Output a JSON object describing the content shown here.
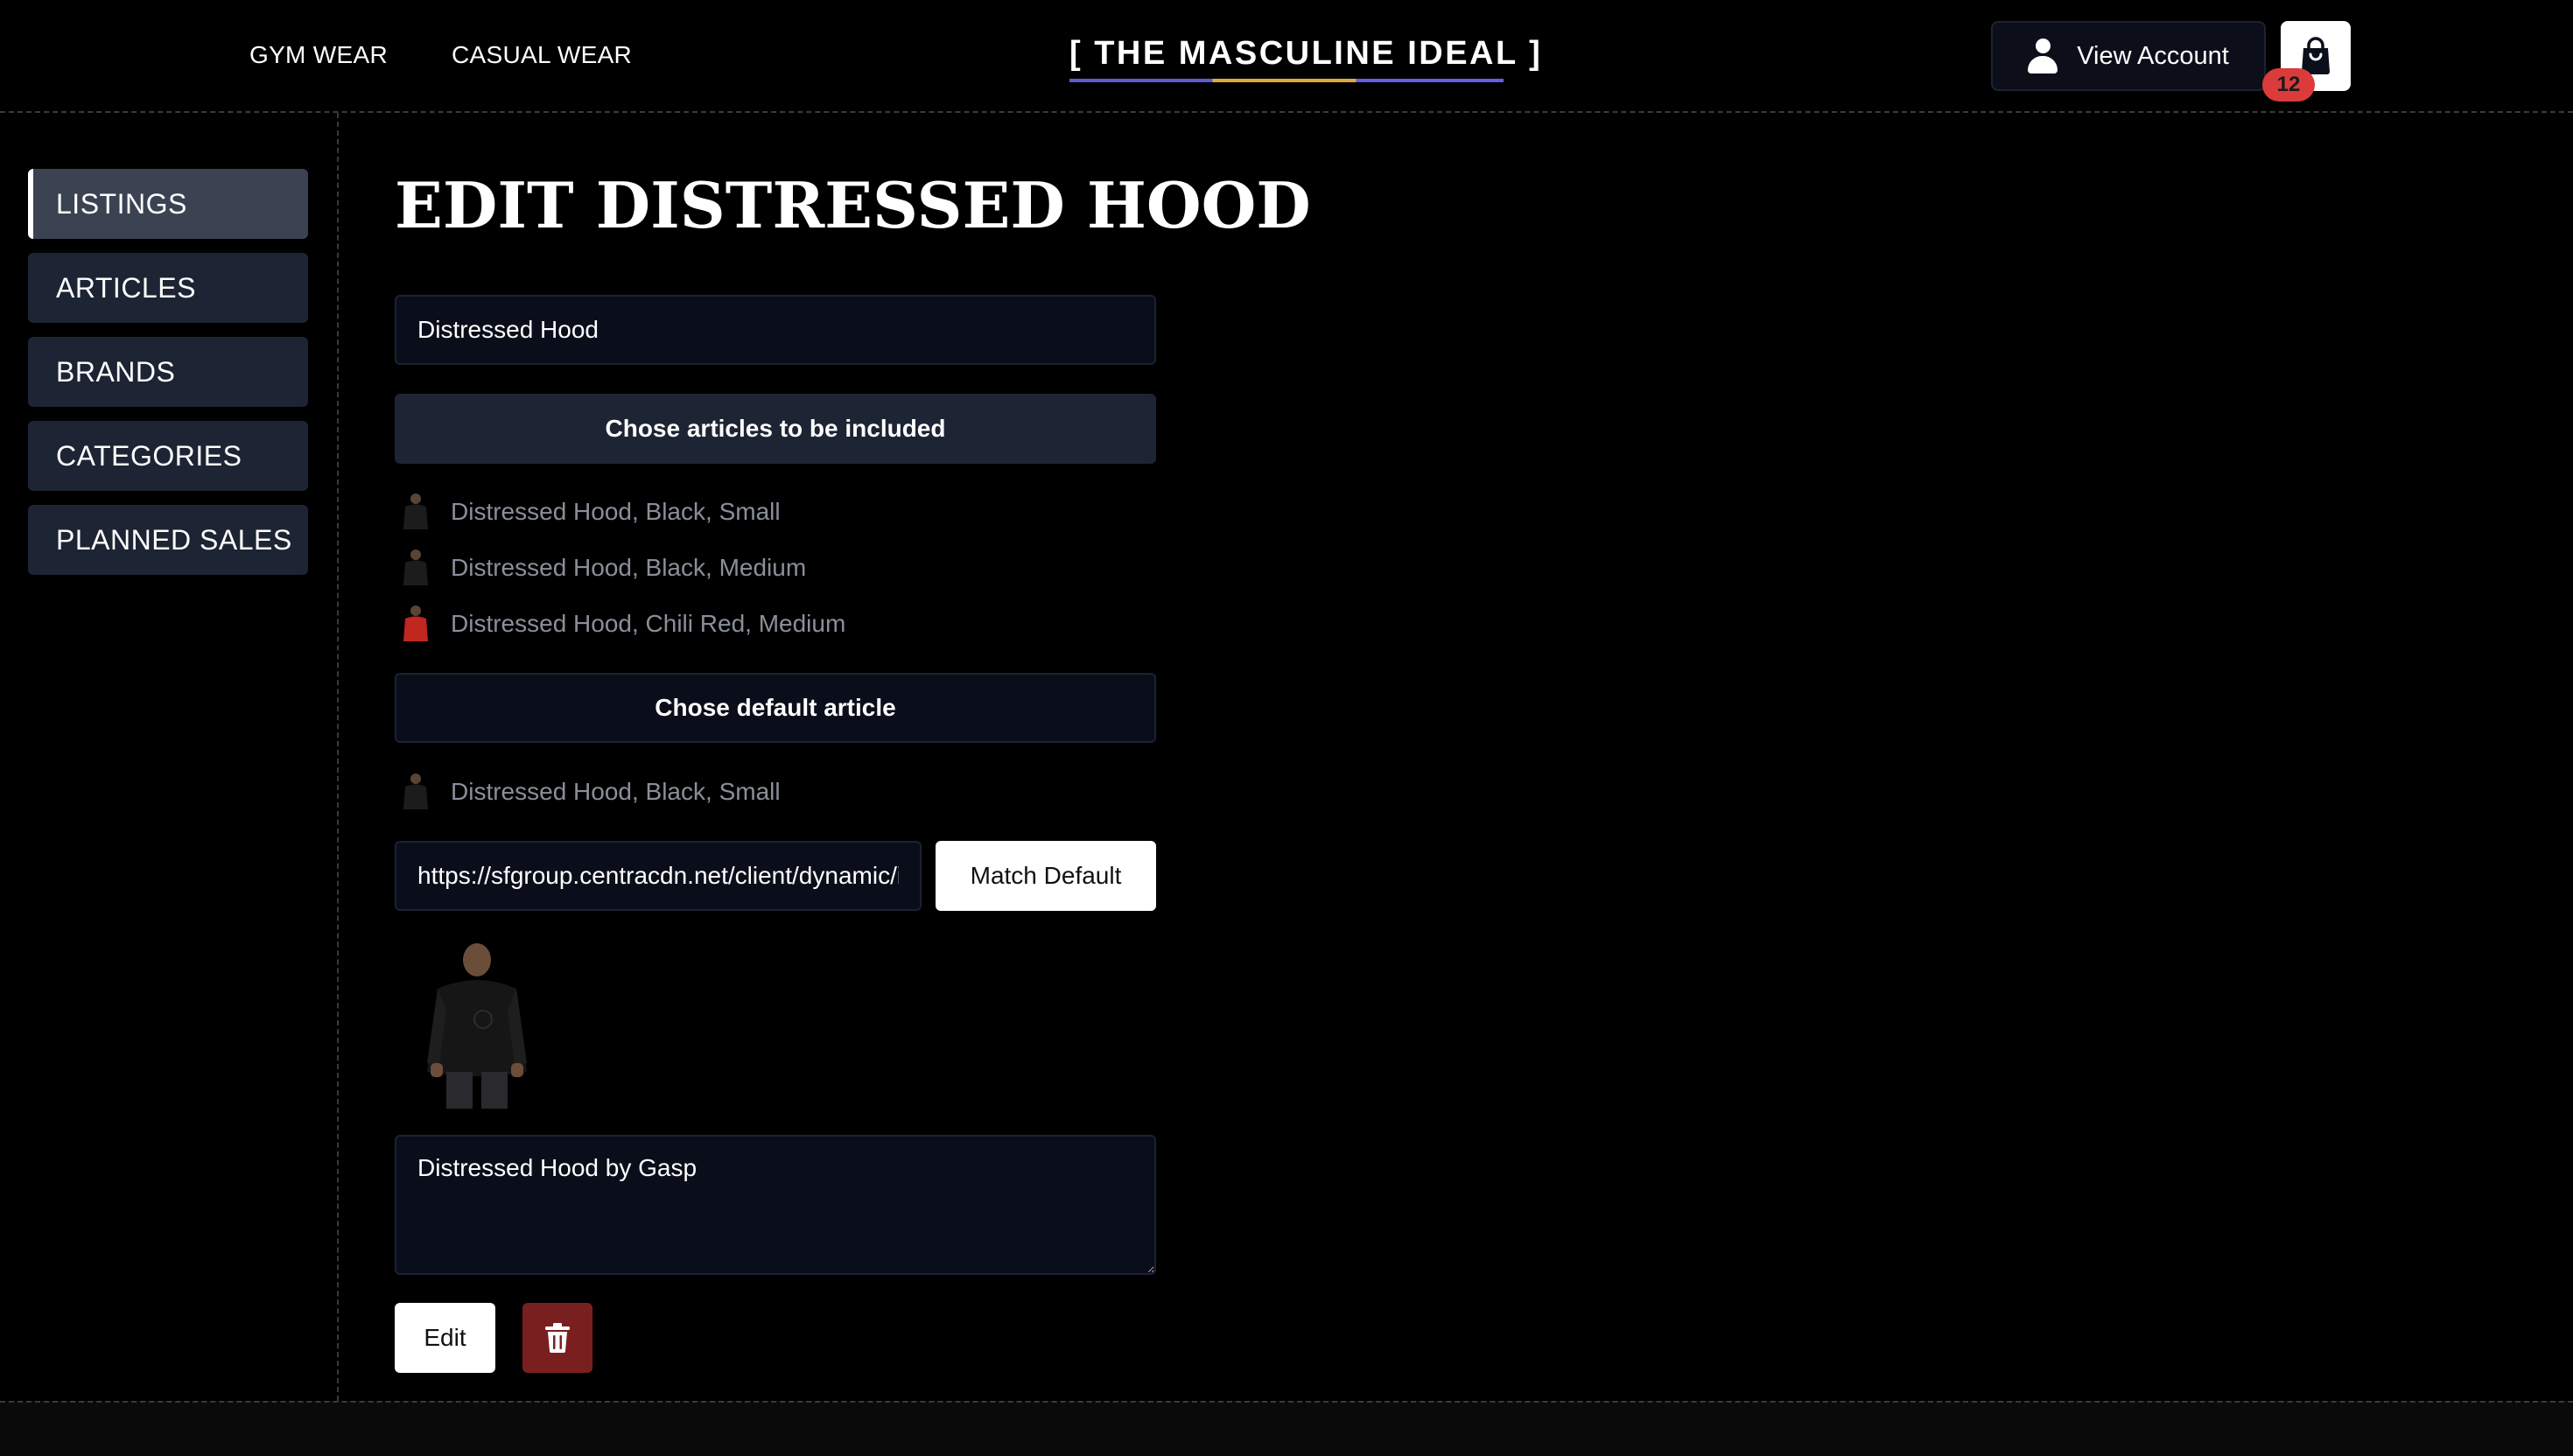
{
  "header": {
    "nav": [
      {
        "label": "GYM WEAR"
      },
      {
        "label": "CASUAL WEAR"
      }
    ],
    "brand": "[ THE MASCULINE IDEAL ]",
    "account_label": "View Account",
    "cart_count": "12",
    "cart_icon": "shopping-bag-icon",
    "account_icon": "user-icon"
  },
  "sidebar": {
    "items": [
      {
        "label": "LISTINGS",
        "active": true
      },
      {
        "label": "ARTICLES",
        "active": false
      },
      {
        "label": "BRANDS",
        "active": false
      },
      {
        "label": "CATEGORIES",
        "active": false
      },
      {
        "label": "PLANNED SALES",
        "active": false
      }
    ]
  },
  "main": {
    "title": "EDIT DISTRESSED HOOD",
    "name_value": "Distressed Hood",
    "articles_button": "Chose articles to be included",
    "included_articles": [
      {
        "label": "Distressed Hood, Black, Small",
        "color": "#1c1c1c"
      },
      {
        "label": "Distressed Hood, Black, Medium",
        "color": "#1c1c1c"
      },
      {
        "label": "Distressed Hood, Chili Red, Medium",
        "color": "#c0271f"
      }
    ],
    "default_button": "Chose default article",
    "default_article": {
      "label": "Distressed Hood, Black, Small",
      "color": "#1c1c1c"
    },
    "image_url_value": "https://sfgroup.centracdn.net/client/dynamic/images/",
    "match_default_button": "Match Default",
    "description_value": "Distressed Hood by Gasp",
    "edit_button": "Edit",
    "delete_icon": "trash-icon"
  },
  "colors": {
    "background": "#000000",
    "panel": "#1d2433",
    "input_bg": "#0a0e1a",
    "delete": "#7a1f1f",
    "badge": "#dc3b3b"
  }
}
